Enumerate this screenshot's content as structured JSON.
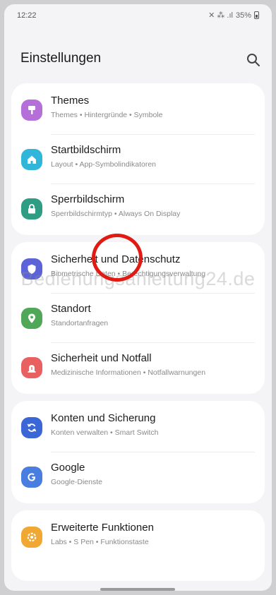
{
  "statusbar": {
    "time": "12:22",
    "indicators": "✕ ⁂ .ıl",
    "battery": "35%"
  },
  "header": {
    "title": "Einstellungen",
    "search_icon": "search-icon"
  },
  "groups": [
    {
      "items": [
        {
          "label": "Themes",
          "sub": "Themes • Hintergründe • Symbole",
          "icon": "themes-brush-icon",
          "color": "#b56fd9"
        },
        {
          "label": "Startbildschirm",
          "sub": "Layout • App-Symbolindikatoren",
          "icon": "home-icon",
          "color": "#2fb6d9"
        },
        {
          "label": "Sperrbildschirm",
          "sub": "Sperrbildschirmtyp • Always On Display",
          "icon": "lock-icon",
          "color": "#2f9d84"
        }
      ]
    },
    {
      "items": [
        {
          "label": "Sicherheit und Datenschutz",
          "sub": "Biometrische Daten • Berechtigungsverwaltung",
          "icon": "shield-icon",
          "color": "#5b63d6"
        },
        {
          "label": "Standort",
          "sub": "Standortanfragen",
          "icon": "location-pin-icon",
          "color": "#4fa757"
        },
        {
          "label": "Sicherheit und Notfall",
          "sub": "Medizinische Informationen • Notfallwarnungen",
          "icon": "emergency-icon",
          "color": "#e86060"
        }
      ]
    },
    {
      "items": [
        {
          "label": "Konten und Sicherung",
          "sub": "Konten verwalten • Smart Switch",
          "icon": "sync-icon",
          "color": "#3a66d6"
        },
        {
          "label": "Google",
          "sub": "Google-Dienste",
          "icon": "google-icon",
          "color": "#4a7de0"
        }
      ]
    },
    {
      "items": [
        {
          "label": "Erweiterte Funktionen",
          "sub": "Labs • S Pen • Funktionstaste",
          "icon": "gear-plus-icon",
          "color": "#f0a832"
        }
      ]
    }
  ],
  "watermark": "Bedienungsanleitung24.de"
}
